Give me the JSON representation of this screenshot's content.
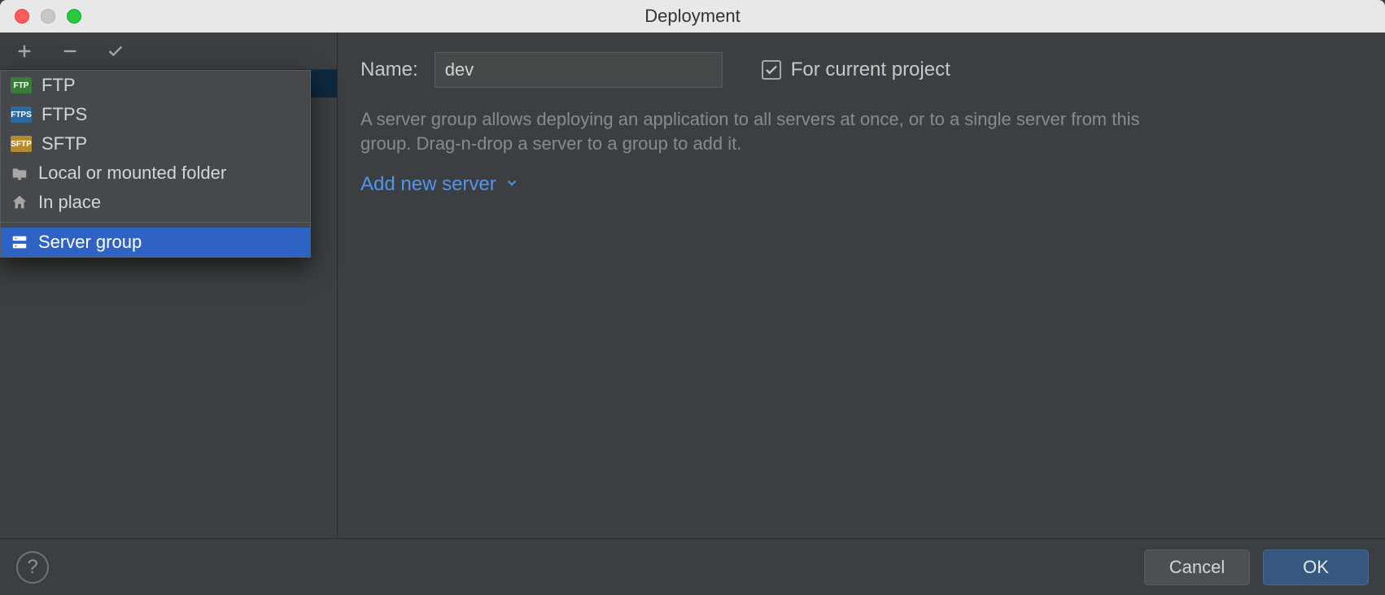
{
  "window": {
    "title": "Deployment"
  },
  "toolbar": {
    "add_tooltip": "Add",
    "remove_tooltip": "Remove",
    "check_tooltip": "Use as default"
  },
  "popup": {
    "items": [
      {
        "label": "FTP",
        "icon": "ftp-badge"
      },
      {
        "label": "FTPS",
        "icon": "ftps-badge"
      },
      {
        "label": "SFTP",
        "icon": "sftp-badge"
      },
      {
        "label": "Local or mounted folder",
        "icon": "folder-icon"
      },
      {
        "label": "In place",
        "icon": "home-icon"
      }
    ],
    "group_label": "Server group"
  },
  "form": {
    "name_label": "Name:",
    "name_value": "dev",
    "for_current_project_label": "For current project",
    "for_current_project_checked": true,
    "description": "A server group allows deploying an application to all servers at once, or to a single server from this group. Drag-n-drop a server to a group to add it.",
    "add_server_label": "Add new server"
  },
  "footer": {
    "help_tooltip": "Help",
    "cancel_label": "Cancel",
    "ok_label": "OK"
  }
}
